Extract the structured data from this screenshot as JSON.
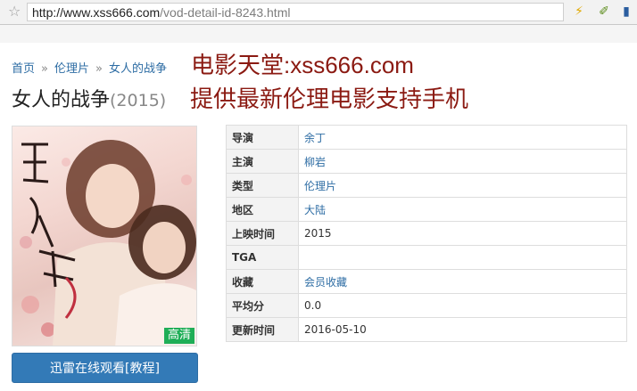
{
  "browser": {
    "url_host": "http://www.xss666.com",
    "url_path": "/vod-detail-id-8243.html"
  },
  "breadcrumb": {
    "home": "首页",
    "category": "伦理片",
    "current": "女人的战争"
  },
  "watermark": {
    "line1": "电影天堂:xss666.com",
    "line2": "提供最新伦理电影支持手机"
  },
  "movie": {
    "title": "女人的战争",
    "year": "(2015)",
    "hd_badge": "高清",
    "watch_button": "迅雷在线观看[教程]"
  },
  "info": {
    "rows": [
      {
        "key": "导演",
        "value": "余丁",
        "link": true
      },
      {
        "key": "主演",
        "value": "柳岩",
        "link": true
      },
      {
        "key": "类型",
        "value": "伦理片",
        "link": true
      },
      {
        "key": "地区",
        "value": "大陆",
        "link": true
      },
      {
        "key": "上映时间",
        "value": "2015",
        "link": false
      },
      {
        "key": "TGA",
        "value": "",
        "link": false
      },
      {
        "key": "收藏",
        "value": "会员收藏",
        "link": true
      },
      {
        "key": "平均分",
        "value": "0.0",
        "link": false
      },
      {
        "key": "更新时间",
        "value": "2016-05-10",
        "link": false
      }
    ]
  },
  "colors": {
    "link": "#2e6da4",
    "button": "#337ab7",
    "watermark": "#8b1a12",
    "badge": "#1fae57"
  }
}
